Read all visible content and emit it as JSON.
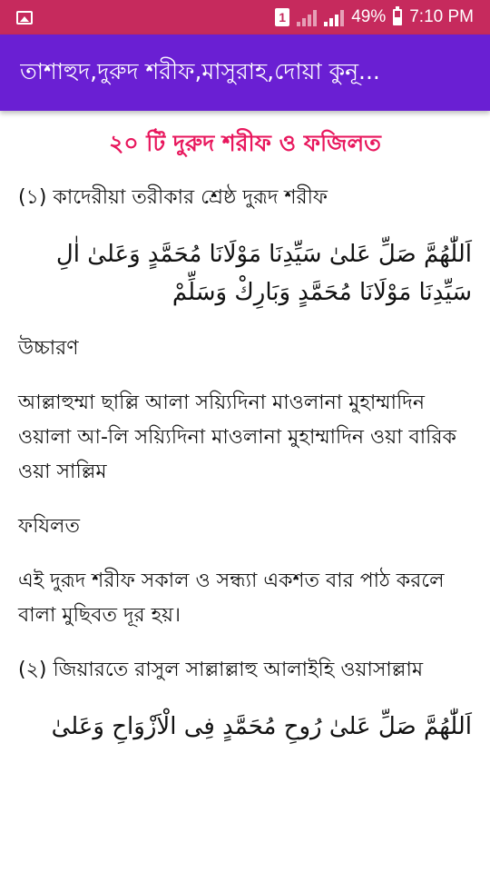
{
  "status_bar": {
    "sim_number": "1",
    "battery_percent": "49%",
    "time": "7:10 PM",
    "icons": [
      "gallery-icon",
      "sim-icon",
      "signal-icon",
      "battery-icon"
    ],
    "bg_color": "#c62a5d"
  },
  "app_bar": {
    "title": "তাশাহুদ,দুরুদ শরীফ,মাসুরাহ,দোয়া কুনূ...",
    "bg_color": "#6a1fd3"
  },
  "content": {
    "heading": "২০ টি দুরুদ শরীফ ও ফজিলত",
    "heading_color": "#e8175d",
    "blocks": [
      "(১) কাদেরীয়া তরীকার শ্রেষ্ঠ দুরূদ শরীফ",
      "اَللّٰهُمَّ صَلِّ عَلىٰ سَيِّدِنَا مَوْلَانَا مُحَمَّدٍ وَعَلىٰ اٰلِ سَيِّدِنَا مَوْلَانَا مُحَمَّدٍ وَبَارِكْ وَسَلِّمْ",
      "উচ্চারণ",
      "আল্লাহুম্মা ছাল্লি আলা সয়্যিদিনা মাওলানা মুহাম্মাদিন ওয়ালা আ-লি সয়্যিদিনা মাওলানা মুহাম্মাদিন ওয়া বারিক ওয়া সাল্লিম",
      "ফযিলত",
      "এই দুরূদ শরীফ সকাল ও সন্ধ্যা একশত বার পাঠ করলে বালা মুছিবত দূর হয়।",
      "(২) জিয়ারতে রাসুল সাল্লাল্লাহু আলাইহি ওয়াসাল্লাম",
      "اَللّٰهُمَّ صَلِّ عَلىٰ رُوحِ مُحَمَّدٍ فِى الْاَزْوَاحِ وَعَلىٰ"
    ]
  }
}
